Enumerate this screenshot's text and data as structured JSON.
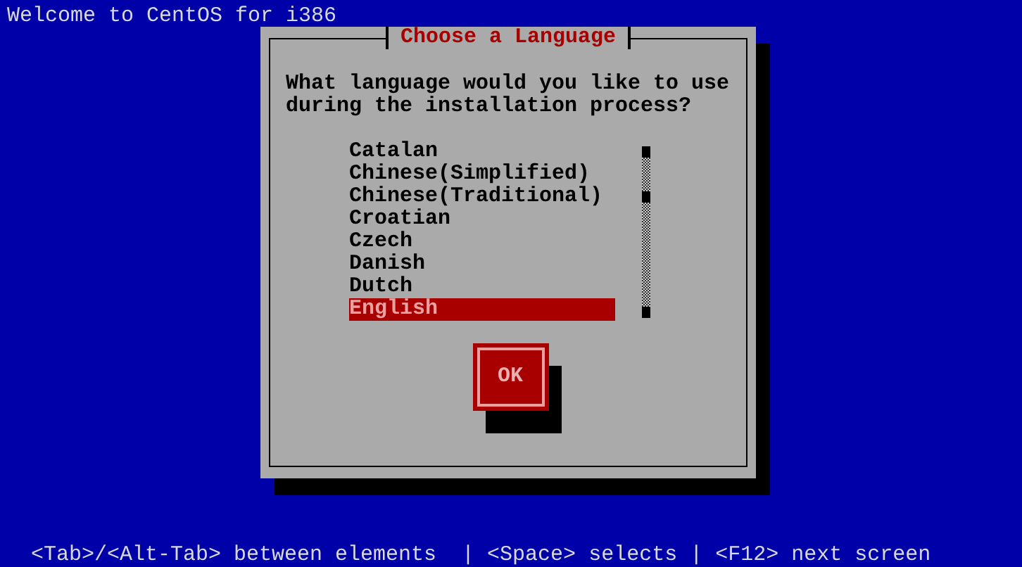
{
  "screen_title": "Welcome to CentOS for i386",
  "dialog": {
    "title": "Choose a Language",
    "prompt": "What language would you like to use during the installation process?",
    "languages": [
      {
        "label": "Catalan",
        "selected": false
      },
      {
        "label": "Chinese(Simplified)",
        "selected": false
      },
      {
        "label": "Chinese(Traditional)",
        "selected": false
      },
      {
        "label": "Croatian",
        "selected": false
      },
      {
        "label": "Czech",
        "selected": false
      },
      {
        "label": "Danish",
        "selected": false
      },
      {
        "label": "Dutch",
        "selected": false
      },
      {
        "label": "English",
        "selected": true
      }
    ],
    "button": "OK"
  },
  "help_line": "<Tab>/<Alt-Tab> between elements  | <Space> selects | <F12> next screen"
}
